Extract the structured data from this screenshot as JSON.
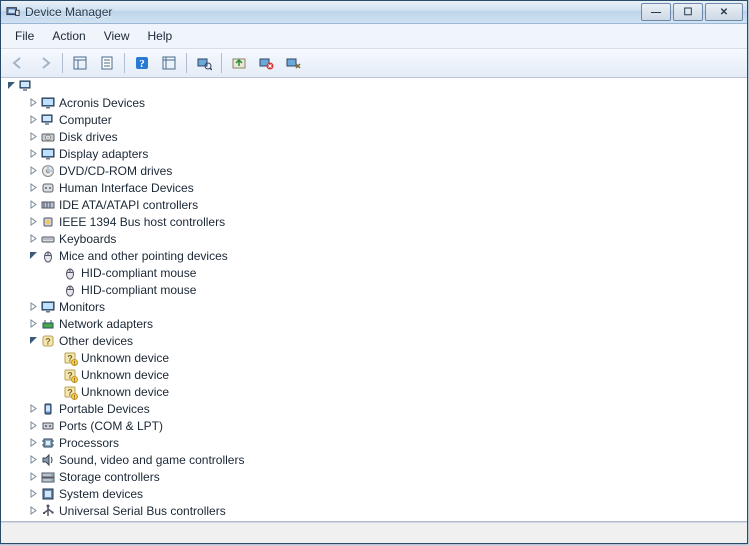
{
  "window": {
    "title": "Device Manager"
  },
  "menu": {
    "file": "File",
    "action": "Action",
    "view": "View",
    "help": "Help"
  },
  "toolbar": {
    "back": "Back",
    "forward": "Forward",
    "show_hide": "Show/Hide Console Tree",
    "properties": "Properties",
    "help": "Help",
    "export": "Export List",
    "scan": "Scan for hardware changes",
    "update_driver": "Update driver",
    "uninstall": "Uninstall",
    "disable": "Disable"
  },
  "root": {
    "label": ""
  },
  "categories": [
    {
      "label": "Acronis Devices",
      "expanded": false,
      "icon": "monitor"
    },
    {
      "label": "Computer",
      "expanded": false,
      "icon": "computer"
    },
    {
      "label": "Disk drives",
      "expanded": false,
      "icon": "disk"
    },
    {
      "label": "Display adapters",
      "expanded": false,
      "icon": "monitor"
    },
    {
      "label": "DVD/CD-ROM drives",
      "expanded": false,
      "icon": "cd"
    },
    {
      "label": "Human Interface Devices",
      "expanded": false,
      "icon": "hid"
    },
    {
      "label": "IDE ATA/ATAPI controllers",
      "expanded": false,
      "icon": "ide"
    },
    {
      "label": "IEEE 1394 Bus host controllers",
      "expanded": false,
      "icon": "firewire"
    },
    {
      "label": "Keyboards",
      "expanded": false,
      "icon": "keyboard"
    },
    {
      "label": "Mice and other pointing devices",
      "expanded": true,
      "icon": "mouse",
      "children": [
        {
          "label": "HID-compliant mouse",
          "icon": "mouse"
        },
        {
          "label": "HID-compliant mouse",
          "icon": "mouse"
        }
      ]
    },
    {
      "label": "Monitors",
      "expanded": false,
      "icon": "monitor"
    },
    {
      "label": "Network adapters",
      "expanded": false,
      "icon": "network"
    },
    {
      "label": "Other devices",
      "expanded": true,
      "icon": "other",
      "children": [
        {
          "label": "Unknown device",
          "icon": "unknown"
        },
        {
          "label": "Unknown device",
          "icon": "unknown"
        },
        {
          "label": "Unknown device",
          "icon": "unknown"
        }
      ]
    },
    {
      "label": "Portable Devices",
      "expanded": false,
      "icon": "portable"
    },
    {
      "label": "Ports (COM & LPT)",
      "expanded": false,
      "icon": "ports"
    },
    {
      "label": "Processors",
      "expanded": false,
      "icon": "cpu"
    },
    {
      "label": "Sound, video and game controllers",
      "expanded": false,
      "icon": "sound"
    },
    {
      "label": "Storage controllers",
      "expanded": false,
      "icon": "storage"
    },
    {
      "label": "System devices",
      "expanded": false,
      "icon": "system"
    },
    {
      "label": "Universal Serial Bus controllers",
      "expanded": false,
      "icon": "usb"
    }
  ]
}
